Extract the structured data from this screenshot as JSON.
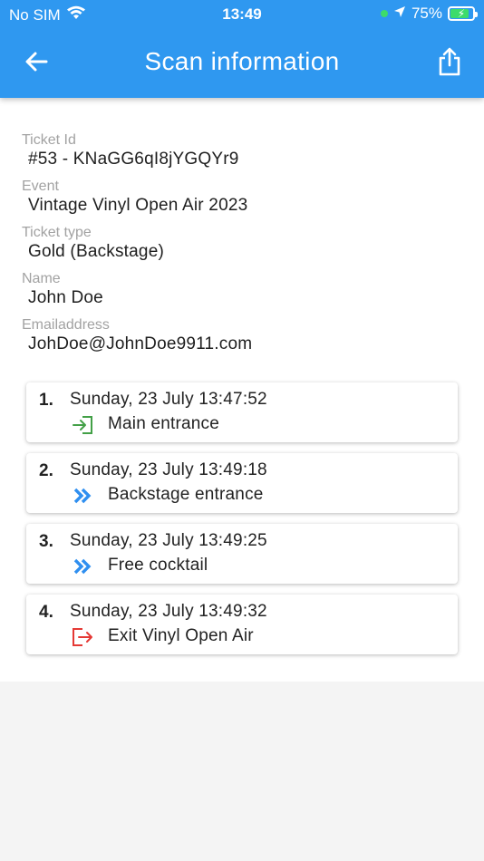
{
  "status_bar": {
    "carrier": "No SIM",
    "time": "13:49",
    "battery": "75%"
  },
  "header": {
    "title": "Scan information"
  },
  "colors": {
    "app_bar": "#2f98f0",
    "enter_green": "#43a047",
    "pass_blue": "#2f8ff0",
    "exit_red": "#e53935"
  },
  "details": [
    {
      "label": "Ticket Id",
      "value": "#53  -  KNaGG6qI8jYGQYr9"
    },
    {
      "label": "Event",
      "value": "Vintage Vinyl Open Air 2023"
    },
    {
      "label": "Ticket type",
      "value": "Gold (Backstage)"
    },
    {
      "label": "Name",
      "value": "John Doe"
    },
    {
      "label": "Emailaddress",
      "value": "JohDoe@JohnDoe9911.com"
    }
  ],
  "scans": [
    {
      "number": "1.",
      "time": "Sunday, 23 July 13:47:52",
      "location": "Main entrance",
      "icon": "enter-icon"
    },
    {
      "number": "2.",
      "time": "Sunday, 23 July 13:49:18",
      "location": "Backstage entrance",
      "icon": "double-chevron-right-icon"
    },
    {
      "number": "3.",
      "time": "Sunday, 23 July 13:49:25",
      "location": "Free cocktail",
      "icon": "double-chevron-right-icon"
    },
    {
      "number": "4.",
      "time": "Sunday, 23 July 13:49:32",
      "location": "Exit Vinyl Open Air",
      "icon": "exit-icon"
    }
  ]
}
